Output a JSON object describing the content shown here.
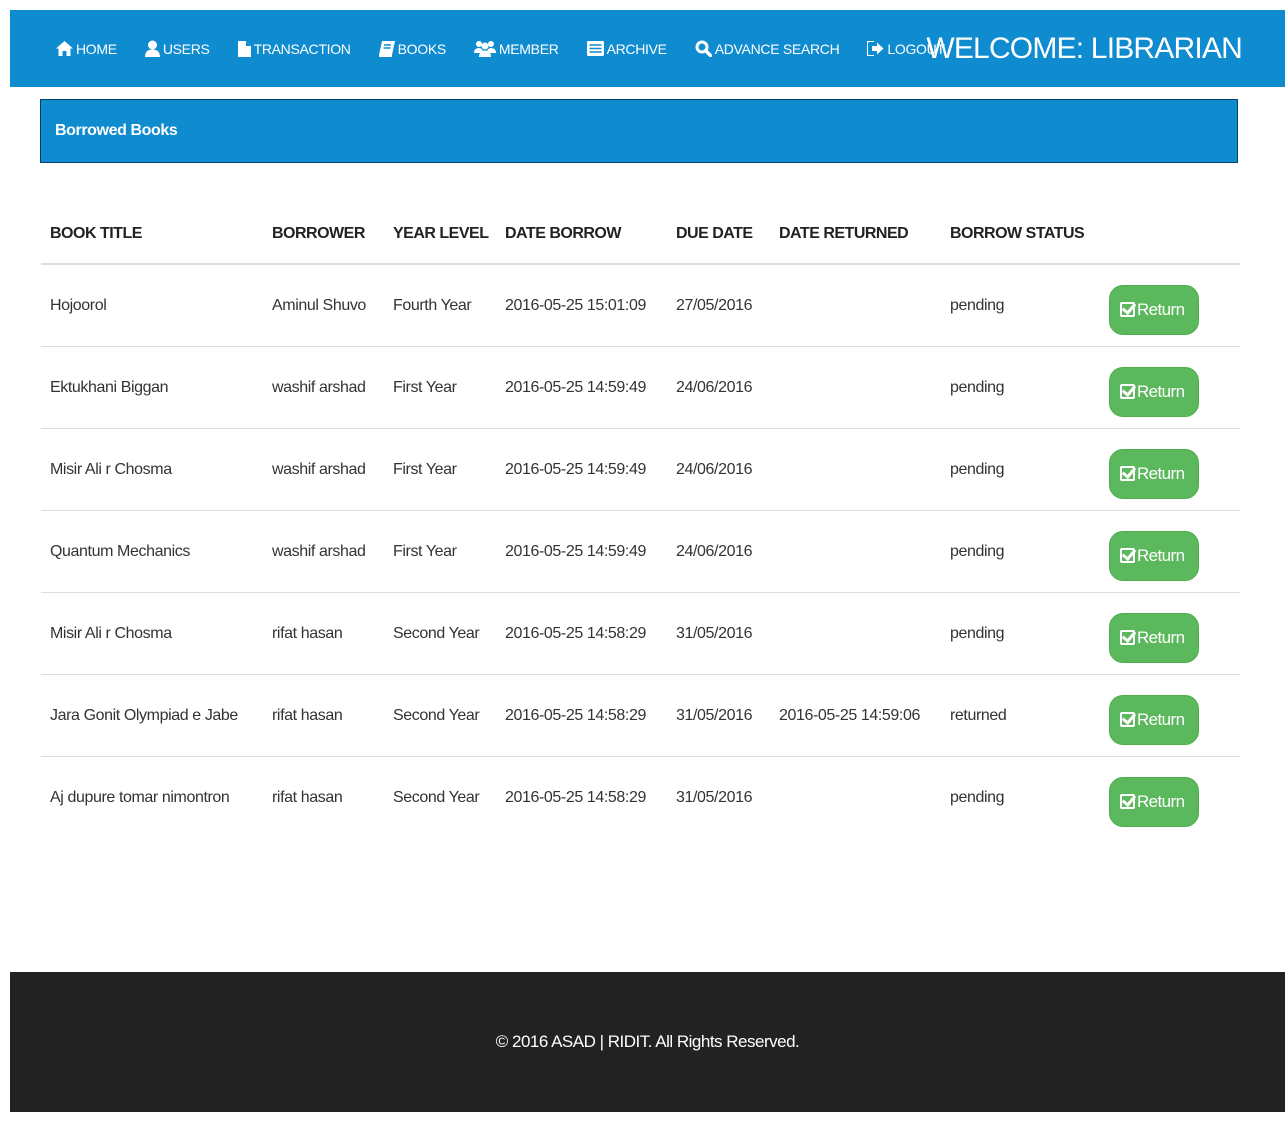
{
  "nav": {
    "items": [
      {
        "label": "HOME",
        "icon": "home-icon"
      },
      {
        "label": "USERS",
        "icon": "user-icon"
      },
      {
        "label": "TRANSACTION",
        "icon": "file-icon"
      },
      {
        "label": "BOOKS",
        "icon": "book-icon"
      },
      {
        "label": "MEMBER",
        "icon": "members-icon"
      },
      {
        "label": "ARCHIVE",
        "icon": "list-icon"
      },
      {
        "label": "ADVANCE SEARCH",
        "icon": "search-icon"
      },
      {
        "label": "LOGOUT",
        "icon": "logout-icon"
      }
    ],
    "welcome": "WELCOME: LIBRARIAN",
    "color": "#0f8bd0"
  },
  "panel": {
    "title": "Borrowed Books"
  },
  "table": {
    "headers": [
      "BOOK TITLE",
      "BORROWER",
      "YEAR LEVEL",
      "DATE BORROW",
      "DUE DATE",
      "DATE RETURNED",
      "BORROW STATUS"
    ],
    "rows": [
      {
        "title": "Hojoorol",
        "borrower": "Aminul Shuvo",
        "year": "Fourth Year",
        "borrowed": "2016-05-25 15:01:09",
        "due": "27/05/2016",
        "returned": "",
        "status": "pending",
        "action": "Return"
      },
      {
        "title": "Ektukhani Biggan",
        "borrower": "washif arshad",
        "year": "First Year",
        "borrowed": "2016-05-25 14:59:49",
        "due": "24/06/2016",
        "returned": "",
        "status": "pending",
        "action": "Return"
      },
      {
        "title": "Misir Ali r Chosma",
        "borrower": "washif arshad",
        "year": "First Year",
        "borrowed": "2016-05-25 14:59:49",
        "due": "24/06/2016",
        "returned": "",
        "status": "pending",
        "action": "Return"
      },
      {
        "title": "Quantum Mechanics",
        "borrower": "washif arshad",
        "year": "First Year",
        "borrowed": "2016-05-25 14:59:49",
        "due": "24/06/2016",
        "returned": "",
        "status": "pending",
        "action": "Return"
      },
      {
        "title": "Misir Ali r Chosma",
        "borrower": "rifat hasan",
        "year": "Second Year",
        "borrowed": "2016-05-25 14:58:29",
        "due": "31/05/2016",
        "returned": "",
        "status": "pending",
        "action": "Return"
      },
      {
        "title": "Jara Gonit Olympiad e Jabe",
        "borrower": "rifat hasan",
        "year": "Second Year",
        "borrowed": "2016-05-25 14:58:29",
        "due": "31/05/2016",
        "returned": "2016-05-25 14:59:06",
        "status": "returned",
        "action": "Return"
      },
      {
        "title": "Aj dupure tomar nimontron",
        "borrower": "rifat hasan",
        "year": "Second Year",
        "borrowed": "2016-05-25 14:58:29",
        "due": "31/05/2016",
        "returned": "",
        "status": "pending",
        "action": "Return"
      }
    ],
    "button_color": "#5cb85c"
  },
  "footer": {
    "text": "© 2016 ASAD | RIDIT. All Rights Reserved."
  }
}
